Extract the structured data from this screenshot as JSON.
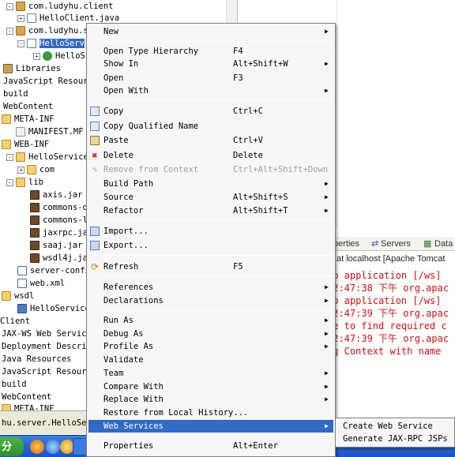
{
  "tree": {
    "items": [
      {
        "label": "com.ludyhu.client",
        "icon": "package-icon"
      },
      {
        "label": "HelloClient.java",
        "icon": "java-file-icon"
      },
      {
        "label": "com.ludyhu.s",
        "icon": "package-icon"
      },
      {
        "label": "HelloServ",
        "icon": "java-file-icon"
      },
      {
        "label": "HelloS",
        "icon": "class-icon"
      },
      {
        "label": "Libraries",
        "icon": "library-icon"
      },
      {
        "label": "JavaScript Resource",
        "icon": "js-resource-icon"
      },
      {
        "label": "build",
        "icon": "folder-icon"
      },
      {
        "label": "WebContent",
        "icon": "folder-icon"
      },
      {
        "label": "META-INF",
        "icon": "folder-icon"
      },
      {
        "label": "MANIFEST.MF",
        "icon": "file-icon"
      },
      {
        "label": "WEB-INF",
        "icon": "folder-icon"
      },
      {
        "label": "HelloService",
        "icon": "folder-icon"
      },
      {
        "label": "com",
        "icon": "folder-icon"
      },
      {
        "label": "lib",
        "icon": "folder-icon"
      },
      {
        "label": "axis.jar",
        "icon": "jar-icon"
      },
      {
        "label": "commons-d",
        "icon": "jar-icon"
      },
      {
        "label": "commons-l",
        "icon": "jar-icon"
      },
      {
        "label": "jaxrpc.ja",
        "icon": "jar-icon"
      },
      {
        "label": "saaj.jar",
        "icon": "jar-icon"
      },
      {
        "label": "wsdl4j.ja",
        "icon": "jar-icon"
      },
      {
        "label": "server-confi",
        "icon": "xml-file-icon"
      },
      {
        "label": "web.xml",
        "icon": "xml-file-icon"
      },
      {
        "label": "wsdl",
        "icon": "folder-icon"
      },
      {
        "label": "HelloService",
        "icon": "wsdl-icon"
      },
      {
        "label": "Client",
        "icon": "project-icon"
      },
      {
        "label": "JAX-WS Web Services",
        "icon": "web-services-icon"
      },
      {
        "label": "Deployment Descript",
        "icon": "descriptor-icon"
      },
      {
        "label": "Java Resources",
        "icon": "java-resources-icon"
      },
      {
        "label": "JavaScript Resource",
        "icon": "js-resource-icon"
      },
      {
        "label": "build",
        "icon": "folder-icon"
      },
      {
        "label": "WebContent",
        "icon": "folder-icon"
      },
      {
        "label": "META-INF",
        "icon": "folder-icon"
      }
    ],
    "status": "hu.server.HelloServ"
  },
  "console": {
    "tabs": [
      "perties",
      "Servers",
      "Data"
    ],
    "title": "at localhost [Apache Tomcat",
    "lines": [
      "eb application [/ws]",
      "12:47:38 下午 org.apac",
      "eb application [/ws]",
      "12:47:39 下午 org.apac",
      "le to find required c",
      "12:47:39 下午 org.apac",
      "ng Context with name"
    ]
  },
  "menu": {
    "items": [
      {
        "label": "New"
      },
      {
        "label": "Open Type Hierarchy",
        "shortcut": "F4"
      },
      {
        "label": "Show In",
        "shortcut": "Alt+Shift+W"
      },
      {
        "label": "Open",
        "shortcut": "F3"
      },
      {
        "label": "Open With"
      },
      {
        "label": "Copy",
        "shortcut": "Ctrl+C"
      },
      {
        "label": "Copy Qualified Name"
      },
      {
        "label": "Paste",
        "shortcut": "Ctrl+V"
      },
      {
        "label": "Delete",
        "shortcut": "Delete"
      },
      {
        "label": "Remove from Context",
        "shortcut": "Ctrl+Alt+Shift+Down"
      },
      {
        "label": "Build Path"
      },
      {
        "label": "Source",
        "shortcut": "Alt+Shift+S"
      },
      {
        "label": "Refactor",
        "shortcut": "Alt+Shift+T"
      },
      {
        "label": "Import..."
      },
      {
        "label": "Export..."
      },
      {
        "label": "Refresh",
        "shortcut": "F5"
      },
      {
        "label": "References"
      },
      {
        "label": "Declarations"
      },
      {
        "label": "Run As"
      },
      {
        "label": "Debug As"
      },
      {
        "label": "Profile As"
      },
      {
        "label": "Validate"
      },
      {
        "label": "Team"
      },
      {
        "label": "Compare With"
      },
      {
        "label": "Replace With"
      },
      {
        "label": "Restore from Local History..."
      },
      {
        "label": "Web Services"
      },
      {
        "label": "Properties",
        "shortcut": "Alt+Enter"
      }
    ],
    "highlighted": "Web Services",
    "submenu": {
      "items": [
        {
          "label": "Create Web Service"
        },
        {
          "label": "Generate JAX-RPC JSPs"
        }
      ]
    }
  },
  "taskbar": {
    "start_label": "分"
  },
  "colors": {
    "selection": "#316ac5",
    "console_error": "#d01010",
    "taskbar": "#2463d0"
  }
}
